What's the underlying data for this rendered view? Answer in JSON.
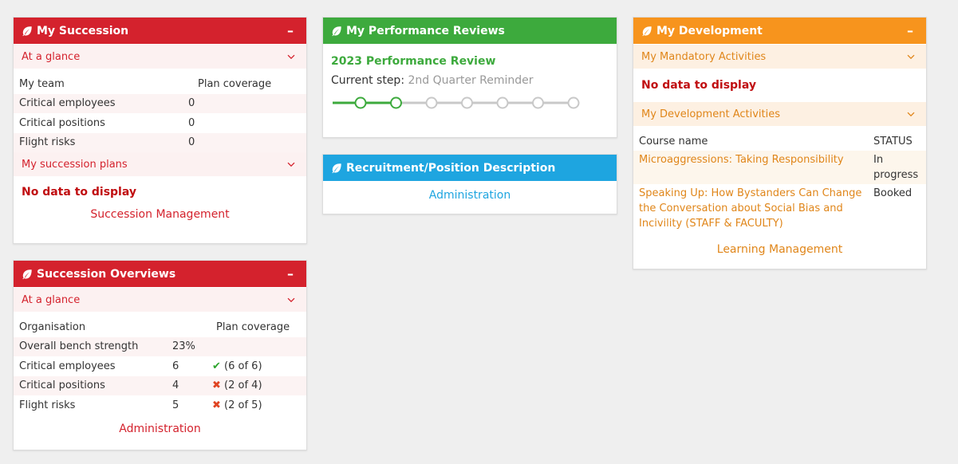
{
  "succession": {
    "title": "My Succession",
    "minimize": "–",
    "at_a_glance": "At a glance",
    "col_team": "My team",
    "col_coverage": "Plan coverage",
    "rows": [
      {
        "label": "Critical employees",
        "value": "0"
      },
      {
        "label": "Critical positions",
        "value": "0"
      },
      {
        "label": "Flight risks",
        "value": "0"
      }
    ],
    "plans_label": "My succession plans",
    "no_data": "No data to display",
    "footer_link": "Succession Management"
  },
  "overviews": {
    "title": "Succession Overviews",
    "minimize": "–",
    "at_a_glance": "At a glance",
    "col_org": "Organisation",
    "col_coverage": "Plan coverage",
    "rows": [
      {
        "label": "Overall bench strength",
        "value": "23%",
        "status": "",
        "coverage": ""
      },
      {
        "label": "Critical employees",
        "value": "6",
        "status": "check",
        "coverage": "(6 of 6)"
      },
      {
        "label": "Critical positions",
        "value": "4",
        "status": "cross",
        "coverage": "(2 of 4)"
      },
      {
        "label": "Flight risks",
        "value": "5",
        "status": "cross",
        "coverage": "(2 of 5)"
      }
    ],
    "footer_link": "Administration"
  },
  "reviews": {
    "title": "My Performance Reviews",
    "review_name": "2023 Performance Review",
    "step_label": "Current step:",
    "step_value": "2nd Quarter Reminder",
    "steps_total": 7,
    "steps_completed": 2
  },
  "recruitment": {
    "title": "Recruitment/Position Description",
    "footer_link": "Administration"
  },
  "development": {
    "title": "My Development",
    "minimize": "–",
    "mandatory_label": "My Mandatory Activities",
    "no_data": "No data to display",
    "activities_label": "My Development Activities",
    "col_course": "Course name",
    "col_status": "STATUS",
    "courses": [
      {
        "name": "Microaggressions: Taking Responsibility",
        "status": "In progress"
      },
      {
        "name": "Speaking Up: How Bystanders Can Change the Conversation about Social Bias and Incivility (STAFF & FACULTY)",
        "status": "Booked"
      }
    ],
    "footer_link": "Learning Management"
  },
  "colors": {
    "succession_red": "#d4222d",
    "reviews_green": "#3daa3d",
    "recruitment_blue": "#1ea5e0",
    "development_orange": "#f7941d"
  },
  "icons": {
    "widget_header": "leaf-icon",
    "section_toggle": "chevron-down-icon",
    "minimize": "minimize-icon",
    "status_ok": "check-icon",
    "status_fail": "cross-icon"
  }
}
